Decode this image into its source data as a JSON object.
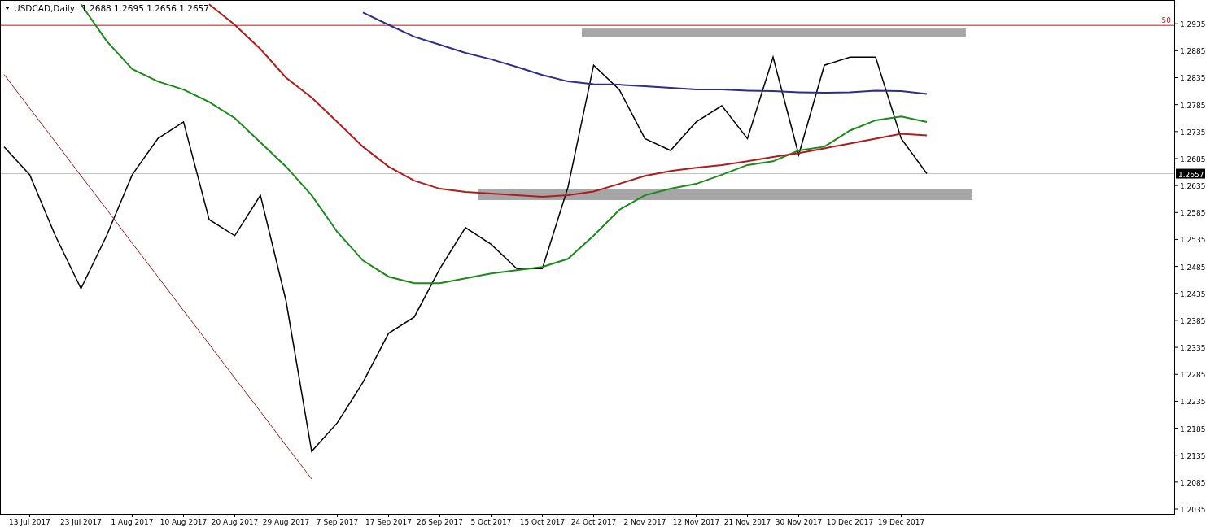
{
  "chart": {
    "symbol": "USDCAD,Daily",
    "ohlc": "1.2688 1.2695 1.2656 1.2657",
    "chart_data": {
      "type": "line",
      "categories": [
        null,
        "13 Jul 2017",
        null,
        "23 Jul 2017",
        null,
        "1 Aug 2017",
        null,
        "10 Aug 2017",
        null,
        "20 Aug 2017",
        null,
        "29 Aug 2017",
        null,
        "7 Sep 2017",
        null,
        "17 Sep 2017",
        null,
        "26 Sep 2017",
        null,
        "5 Oct 2017",
        null,
        "15 Oct 2017",
        null,
        "24 Oct 2017",
        null,
        "2 Nov 2017",
        null,
        "12 Nov 2017",
        null,
        "21 Nov 2017",
        null,
        "30 Nov 2017",
        null,
        "10 Dec 2017",
        null,
        "19 Dec 2017",
        null
      ],
      "ylim": [
        1.2026,
        1.2979
      ],
      "yticks": [
        1.2935,
        1.2885,
        1.2835,
        1.2785,
        1.2735,
        1.2685,
        1.2635,
        1.2585,
        1.2535,
        1.2485,
        1.2435,
        1.2385,
        1.2335,
        1.2285,
        1.2235,
        1.2185,
        1.2135,
        1.2085,
        1.2035
      ],
      "series": [
        {
          "color": "#000000",
          "values": [
            1.2707,
            1.2655,
            1.2542,
            1.2444,
            1.2542,
            1.2655,
            1.2722,
            1.2753,
            1.2572,
            1.2542,
            1.2617,
            1.2421,
            1.2142,
            1.2195,
            1.227,
            1.2361,
            1.2391,
            1.2481,
            1.2557,
            1.2526,
            1.2481,
            1.2481,
            1.2632,
            1.2858,
            1.2813,
            1.2722,
            1.27,
            1.2753,
            1.2783,
            1.2722,
            1.2873,
            1.2692,
            1.2858,
            1.2873,
            1.2873,
            1.2722,
            1.2657
          ]
        },
        {
          "color": "#a01818",
          "values": [
            1.2841,
            1.2778,
            1.2716,
            1.2653,
            1.2591,
            1.2528,
            1.2466,
            1.2403,
            1.2341,
            1.2278,
            1.2216,
            1.2153,
            1.2091,
            null,
            null,
            null,
            null,
            null,
            null,
            null,
            null,
            null,
            null,
            null,
            null,
            null,
            null,
            null,
            null,
            null,
            null,
            null,
            null,
            null,
            null,
            null,
            null
          ]
        },
        {
          "color": "#1a8a1a",
          "values": [
            null,
            null,
            null,
            1.2971,
            1.2903,
            1.2851,
            1.2828,
            1.2813,
            1.279,
            1.276,
            1.2715,
            1.267,
            1.2617,
            1.2549,
            1.2496,
            1.2466,
            1.2454,
            1.2454,
            1.2463,
            1.2472,
            1.2478,
            1.2484,
            1.2499,
            1.2542,
            1.259,
            1.2617,
            1.2629,
            1.2638,
            1.2655,
            1.2673,
            1.268,
            1.27,
            1.2707,
            1.2737,
            1.2756,
            1.2763,
            1.2753
          ]
        },
        {
          "color": "#b01c1c",
          "values": [
            null,
            null,
            null,
            null,
            null,
            null,
            null,
            null,
            1.2971,
            1.2933,
            1.2888,
            1.2835,
            1.2798,
            1.2753,
            1.2707,
            1.267,
            1.2644,
            1.2629,
            1.2623,
            1.262,
            1.2617,
            1.2614,
            1.2617,
            1.2624,
            1.2638,
            1.2653,
            1.2662,
            1.2668,
            1.2673,
            1.268,
            1.2688,
            1.2695,
            1.2704,
            1.2713,
            1.2722,
            1.2731,
            1.2728
          ]
        },
        {
          "color": "#2e2e8a",
          "values": [
            null,
            null,
            null,
            null,
            null,
            null,
            null,
            null,
            null,
            null,
            null,
            null,
            null,
            null,
            1.2956,
            1.2933,
            1.2911,
            1.2896,
            1.2881,
            1.2869,
            1.2855,
            1.284,
            1.2828,
            1.2823,
            1.2822,
            1.2819,
            1.2816,
            1.2813,
            1.2813,
            1.2811,
            1.281,
            1.2808,
            1.2807,
            1.2808,
            1.2811,
            1.281,
            1.2805
          ]
        }
      ],
      "bands": [
        {
          "axis": "y",
          "from": 1.291,
          "to": 1.2926,
          "color": "#a6a6a6"
        },
        {
          "axis": "y",
          "from": 1.2608,
          "to": 1.2628,
          "color": "#a6a6a6"
        }
      ],
      "ref_lines": [
        {
          "axis": "y",
          "value": 1.2932,
          "color": "#c01818"
        },
        {
          "axis": "y",
          "value": 1.2657,
          "color": "#c0c0c0"
        }
      ]
    },
    "level_name": "50",
    "last_price": "1.2657"
  }
}
